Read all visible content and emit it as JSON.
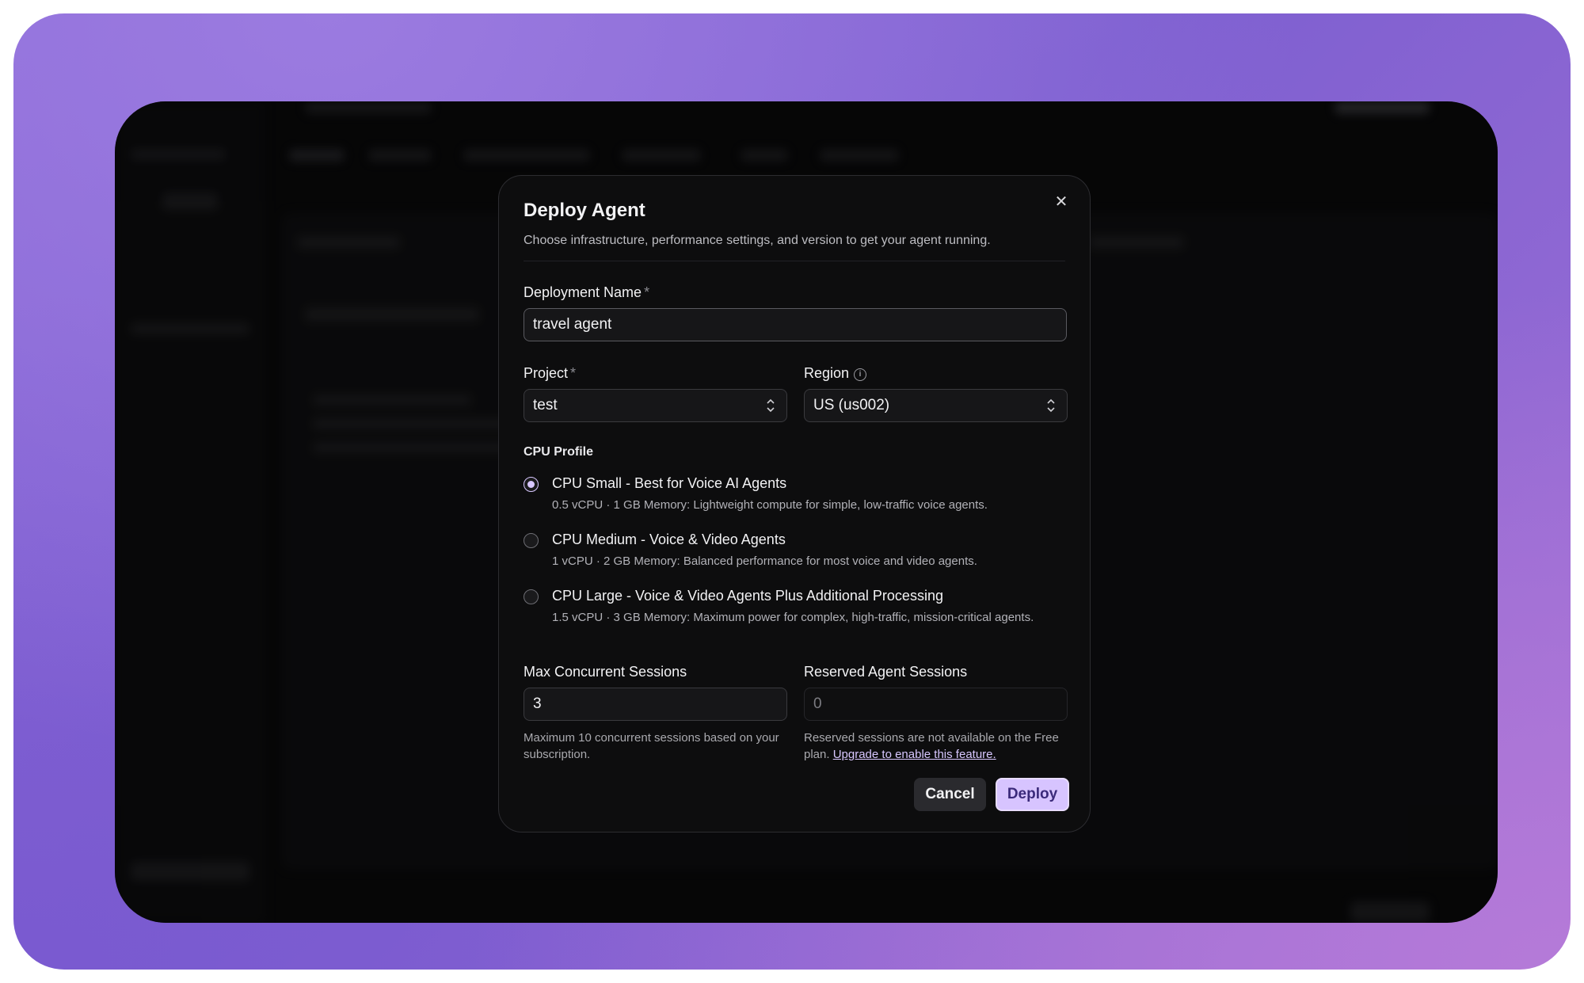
{
  "modal": {
    "title": "Deploy Agent",
    "subtitle": "Choose infrastructure, performance settings, and version to get your agent running.",
    "close_icon": "close-icon"
  },
  "deployment_name": {
    "label": "Deployment Name",
    "required_mark": "*",
    "value": "travel agent"
  },
  "project": {
    "label": "Project",
    "required_mark": "*",
    "value": "test"
  },
  "region": {
    "label": "Region",
    "info_glyph": "i",
    "value": "US (us002)"
  },
  "cpu_profile": {
    "label": "CPU Profile",
    "selected": 0,
    "options": [
      {
        "title": "CPU Small - Best for Voice AI Agents",
        "desc": "0.5 vCPU · 1 GB Memory: Lightweight compute for simple, low-traffic voice agents."
      },
      {
        "title": "CPU Medium - Voice & Video Agents",
        "desc": "1 vCPU · 2 GB Memory: Balanced performance for most voice and video agents."
      },
      {
        "title": "CPU Large - Voice & Video Agents Plus Additional Processing",
        "desc": "1.5 vCPU · 3 GB Memory: Maximum power for complex, high-traffic, mission-critical agents."
      }
    ]
  },
  "max_sessions": {
    "label": "Max Concurrent Sessions",
    "value": "3",
    "help": "Maximum 10 concurrent sessions based on your subscription."
  },
  "reserved_sessions": {
    "label": "Reserved Agent Sessions",
    "value": "0",
    "help": "Reserved sessions are not available on the Free plan.",
    "link": "Upgrade to enable this feature."
  },
  "buttons": {
    "cancel": "Cancel",
    "deploy": "Deploy"
  },
  "colors": {
    "accent": "#d7c4ff",
    "background_gradient_start": "#8c6ad8",
    "background_gradient_end": "#a070d6"
  }
}
